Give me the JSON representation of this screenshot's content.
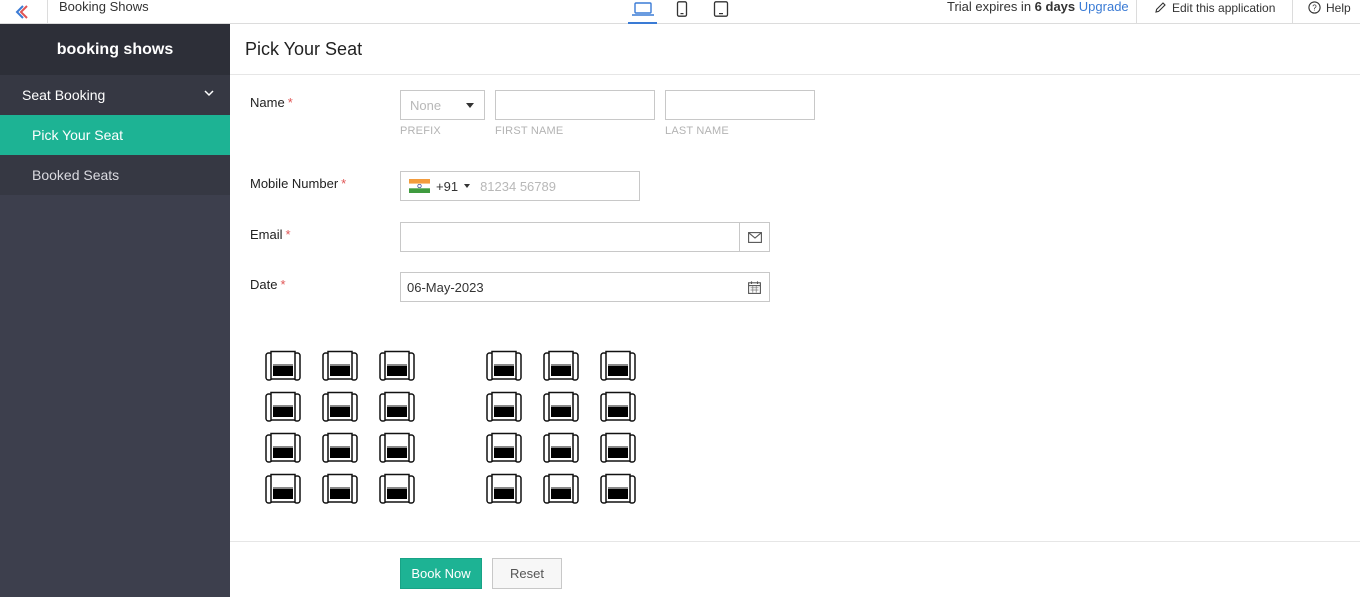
{
  "topbar": {
    "app_title": "Booking Shows",
    "devices": [
      "laptop-icon",
      "mobile-icon",
      "tablet-icon"
    ],
    "trial_prefix": "Trial expires in",
    "trial_days": "6 days",
    "upgrade_label": "Upgrade",
    "edit_label": "Edit this application",
    "help_label": "Help"
  },
  "sidebar": {
    "brand": "booking shows",
    "section_label": "Seat Booking",
    "items": [
      {
        "label": "Pick Your Seat",
        "active": true
      },
      {
        "label": "Booked Seats",
        "active": false
      }
    ]
  },
  "form": {
    "title": "Pick Your Seat",
    "name": {
      "label": "Name",
      "prefix_value": "None",
      "prefix_sublabel": "PREFIX",
      "first_sublabel": "FIRST NAME",
      "last_sublabel": "LAST NAME",
      "first_value": "",
      "last_value": ""
    },
    "mobile": {
      "label": "Mobile Number",
      "country_code": "+91",
      "placeholder": "81234 56789"
    },
    "email": {
      "label": "Email",
      "value": ""
    },
    "date": {
      "label": "Date",
      "value": "06-May-2023"
    },
    "seat_grid": {
      "rows": 4,
      "left_block_columns": 3,
      "right_block_columns": 3
    }
  },
  "actions": {
    "book_label": "Book Now",
    "reset_label": "Reset"
  },
  "colors": {
    "accent": "#1db394",
    "sidebar_bg": "#3d3f4d",
    "brand_bg": "#2d2f38",
    "link": "#3a7bd5",
    "required": "#e05555"
  }
}
